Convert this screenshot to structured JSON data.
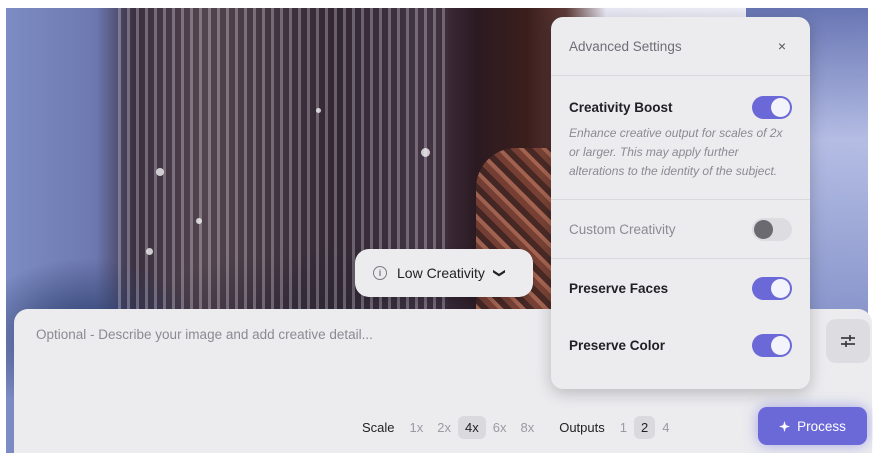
{
  "creativity_pill": {
    "label": "Low Creativity",
    "info_glyph": "i",
    "chevron": "❯"
  },
  "prompt": {
    "placeholder": "Optional - Describe your image and add creative detail..."
  },
  "toolbar": {
    "scale_label": "Scale",
    "scale_options": [
      "1x",
      "2x",
      "4x",
      "6x",
      "8x"
    ],
    "scale_selected": "4x",
    "outputs_label": "Outputs",
    "output_options": [
      "1",
      "2",
      "4"
    ],
    "outputs_selected": "2",
    "process_label": "Process",
    "process_icon": "sparkle-icon"
  },
  "advanced": {
    "title": "Advanced Settings",
    "close": "×",
    "creativity_boost": {
      "label": "Creativity Boost",
      "on": true,
      "description": "Enhance creative output for scales of 2x or larger. This may apply further alterations to the identity of the subject."
    },
    "custom_creativity": {
      "label": "Custom Creativity",
      "on": false
    },
    "preserve_faces": {
      "label": "Preserve Faces",
      "on": true
    },
    "preserve_color": {
      "label": "Preserve Color",
      "on": true
    }
  },
  "colors": {
    "accent": "#6b68d8",
    "panel": "#ececef"
  }
}
